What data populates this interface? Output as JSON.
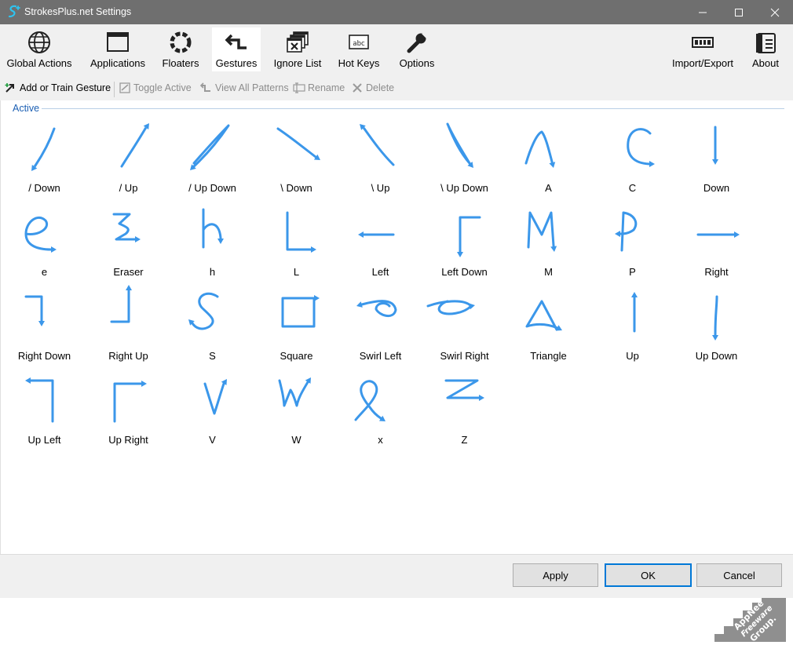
{
  "window": {
    "title": "StrokesPlus.net Settings"
  },
  "toolbar": {
    "items": [
      {
        "label": "Global Actions",
        "icon": "globe-icon"
      },
      {
        "label": "Applications",
        "icon": "window-icon"
      },
      {
        "label": "Floaters",
        "icon": "ring-icon"
      },
      {
        "label": "Gestures",
        "icon": "gesture-arrow-icon",
        "selected": true
      },
      {
        "label": "Ignore List",
        "icon": "ignore-windows-icon"
      },
      {
        "label": "Hot Keys",
        "icon": "keyboard-abc-icon"
      },
      {
        "label": "Options",
        "icon": "wrench-icon"
      },
      {
        "label": "Import/Export",
        "icon": "import-export-icon"
      },
      {
        "label": "About",
        "icon": "about-icon"
      }
    ]
  },
  "subtoolbar": {
    "add": "Add or Train Gesture",
    "toggle": "Toggle Active",
    "view_all": "View All Patterns",
    "rename": "Rename",
    "delete": "Delete"
  },
  "group": {
    "label": "Active"
  },
  "gestures": [
    {
      "label": "/ Down"
    },
    {
      "label": "/ Up"
    },
    {
      "label": "/ Up Down"
    },
    {
      "label": "\\ Down"
    },
    {
      "label": "\\ Up"
    },
    {
      "label": "\\ Up Down"
    },
    {
      "label": "A"
    },
    {
      "label": "C"
    },
    {
      "label": "Down"
    },
    {
      "label": "e"
    },
    {
      "label": "Eraser"
    },
    {
      "label": "h"
    },
    {
      "label": "L"
    },
    {
      "label": "Left"
    },
    {
      "label": "Left Down"
    },
    {
      "label": "M"
    },
    {
      "label": "P"
    },
    {
      "label": "Right"
    },
    {
      "label": "Right Down"
    },
    {
      "label": "Right Up"
    },
    {
      "label": "S"
    },
    {
      "label": "Square"
    },
    {
      "label": "Swirl Left"
    },
    {
      "label": "Swirl Right"
    },
    {
      "label": "Triangle"
    },
    {
      "label": "Up"
    },
    {
      "label": "Up Down"
    },
    {
      "label": "Up Left"
    },
    {
      "label": "Up Right"
    },
    {
      "label": "V"
    },
    {
      "label": "W"
    },
    {
      "label": "x"
    },
    {
      "label": "Z"
    }
  ],
  "watermark": {
    "text": "AppNee Freeware Group."
  },
  "footer": {
    "apply": "Apply",
    "ok": "OK",
    "cancel": "Cancel"
  },
  "colors": {
    "stroke": "#3b97ea",
    "titlebar": "#6f6f6f",
    "accent": "#0078d7"
  }
}
